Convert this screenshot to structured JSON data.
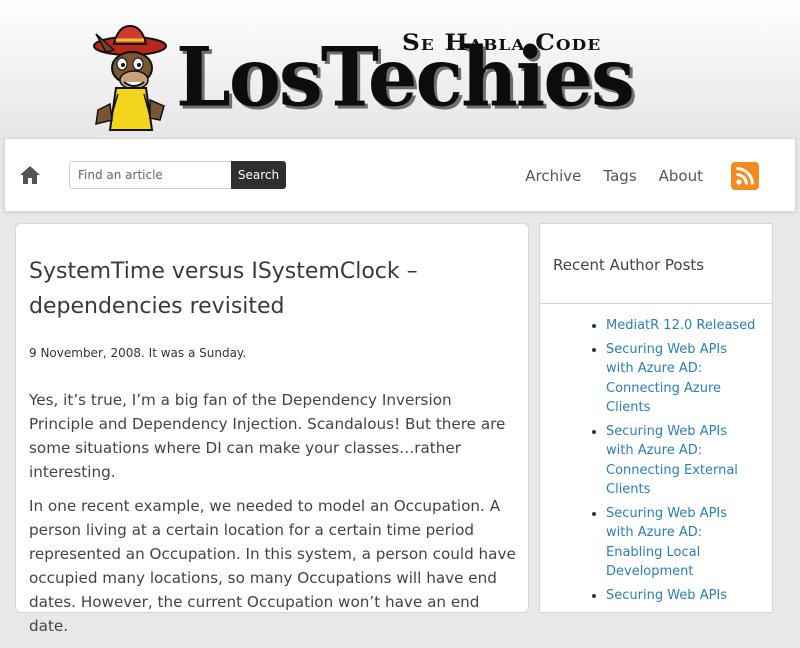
{
  "site": {
    "tagline": "Se Habla Code",
    "logo_text": "LosTechies"
  },
  "nav": {
    "search_placeholder": "Find an article",
    "search_button_label": "Search",
    "links": [
      "Archive",
      "Tags",
      "About"
    ],
    "icons": {
      "home": "home-icon",
      "rss": "rss-feed-icon"
    }
  },
  "post": {
    "title": "SystemTime versus ISystemClock – dependencies revisited",
    "date": "9 November, 2008. It was a Sunday.",
    "paragraphs": [
      "Yes, it’s true, I’m a big fan of the Dependency Inversion Principle and Dependency Injection.  Scandalous!  But there are some situations where DI can make your classes…rather interesting.",
      "In one recent example, we needed to model an Occupation.  A person living at a certain location for a certain time period represented an Occupation.  In this system, a person could have occupied many locations, so many Occupations will have end dates.  However, the current Occupation won’t have an end date."
    ]
  },
  "sidebar": {
    "heading": "Recent Author Posts",
    "items": [
      "MediatR 12.0 Released",
      "Securing Web APIs with Azure AD: Connecting Azure Clients",
      "Securing Web APIs with Azure AD: Connecting External Clients",
      "Securing Web APIs with Azure AD: Enabling Local Development",
      "Securing Web APIs"
    ]
  },
  "colors": {
    "link": "#2a7fb8",
    "rss": "#f6891f",
    "search_button": "#2f2f2f"
  }
}
